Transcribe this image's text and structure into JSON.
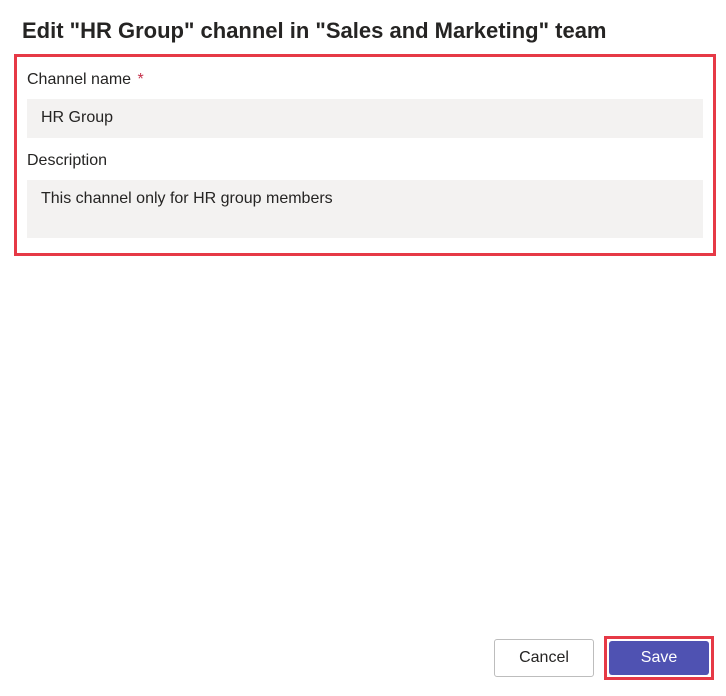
{
  "dialog": {
    "title": "Edit \"HR Group\" channel in \"Sales and Marketing\" team"
  },
  "form": {
    "channel_name": {
      "label": "Channel name",
      "required_marker": "*",
      "value": "HR Group"
    },
    "description": {
      "label": "Description",
      "value": "This channel only for HR group members"
    }
  },
  "buttons": {
    "cancel": "Cancel",
    "save": "Save"
  }
}
